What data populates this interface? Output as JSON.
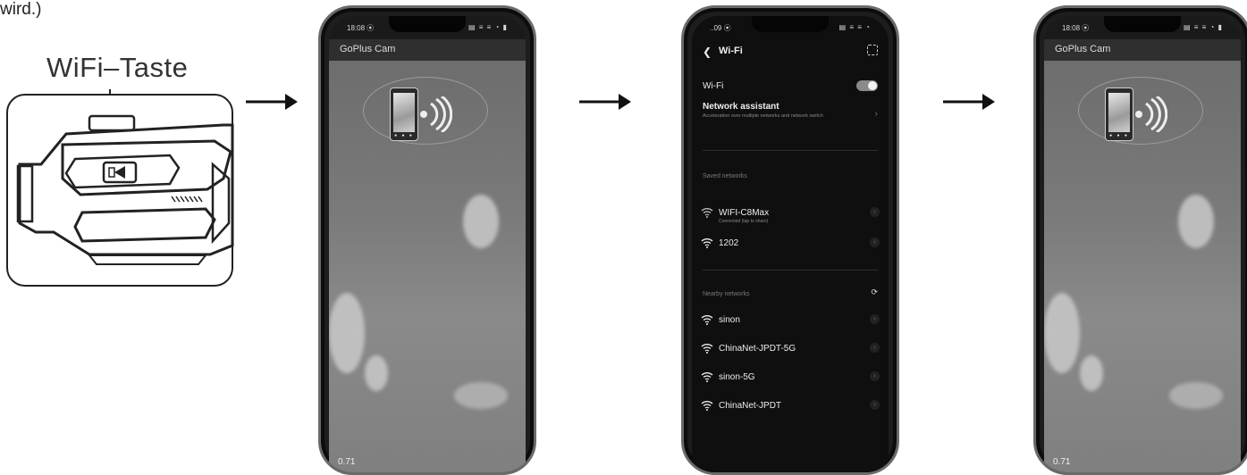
{
  "caption": {
    "top_text": "wird.)",
    "button_label": "WiFi–Taste"
  },
  "steps": {
    "phone1": {
      "status_time": "18:08 ⦿",
      "status_icons": "▤ ≡ ≡ ◔ ▮",
      "app_title": "GoPlus Cam",
      "bottom_num": "0.71"
    },
    "phone2": {
      "status_time": "..09 ⦿",
      "status_icons": "▤ ≡ ≡ ◔",
      "header": {
        "back_icon": "❮",
        "title": "Wi-Fi"
      },
      "wifi_toggle_label": "Wi-Fi",
      "wifi_enabled": true,
      "network_assistant": {
        "label": "Network assistant",
        "description": "Acceleration over multiple networks and network switch"
      },
      "saved_section": "Saved networks",
      "saved_networks": [
        {
          "name": "WIFI-C8Max",
          "status": "Connected (tap to share)"
        },
        {
          "name": "1202",
          "status": ""
        }
      ],
      "nearby_section": "Nearby networks",
      "nearby_networks": [
        {
          "name": "sinon"
        },
        {
          "name": "ChinaNet-JPDT-5G"
        },
        {
          "name": "sinon-5G"
        },
        {
          "name": "ChinaNet-JPDT"
        }
      ],
      "chevron": "›"
    },
    "phone3": {
      "status_time": "18:08 ⦿",
      "status_icons": "▤ ≡ ≡ ◔ ▮",
      "app_title": "GoPlus Cam",
      "bottom_num": "0.71"
    }
  },
  "colors": {
    "ink": "#222222",
    "phone_frame": "#6a6a6a",
    "screen_dark": "#0f0f0f"
  }
}
